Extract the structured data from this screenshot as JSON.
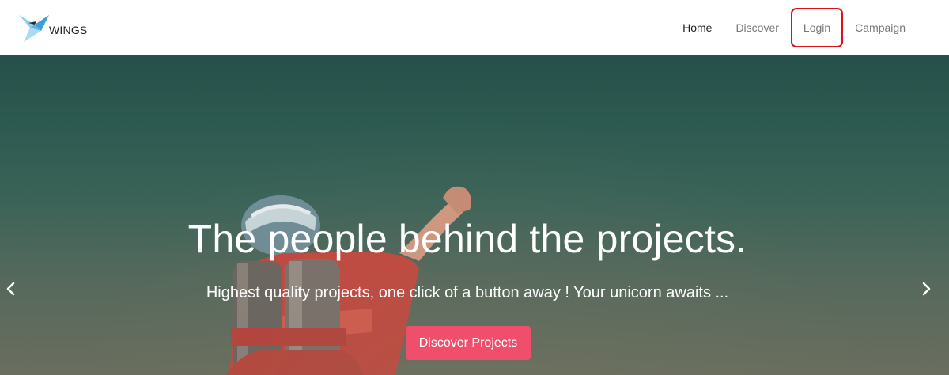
{
  "brand": {
    "name": "WINGS",
    "logo_icon": "origami-bird-icon",
    "logo_color": "#5fb3e3"
  },
  "nav": {
    "items": [
      {
        "label": "Home",
        "active": true
      },
      {
        "label": "Discover",
        "active": false
      },
      {
        "label": "Login",
        "active": false,
        "highlighted": true
      },
      {
        "label": "Campaign",
        "active": false
      }
    ]
  },
  "hero": {
    "title": "The people behind the projects.",
    "subtitle": "Highest quality projects, one click of a button away ! Your unicorn awaits ...",
    "cta_label": "Discover Projects",
    "cta_color": "#ef4f6a",
    "prev_icon": "chevron-left-icon",
    "next_icon": "chevron-right-icon"
  },
  "colors": {
    "highlight_border": "#e0101a",
    "hero_bg": "#2c5950"
  }
}
